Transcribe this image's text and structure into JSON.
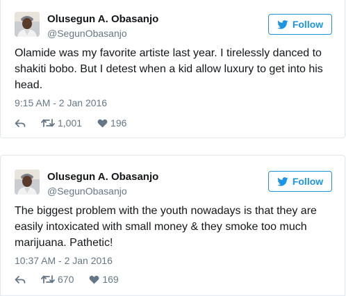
{
  "tweets": [
    {
      "name": "Olusegun A. Obasanjo",
      "handle": "@SegunObasanjo",
      "follow_label": "Follow",
      "text": "Olamide was my favorite artiste last year. I tirelessly danced to shakiti bobo. But I detest when a kid allow luxury to get into his head.",
      "timestamp": "9:15 AM - 2 Jan 2016",
      "retweets": "1,001",
      "likes": "196"
    },
    {
      "name": "Olusegun A. Obasanjo",
      "handle": "@SegunObasanjo",
      "follow_label": "Follow",
      "text": "The biggest problem with the youth nowadays is that they are easily intoxicated with small money & they smoke too much marijuana. Pathetic!",
      "timestamp": "10:37 AM - 2 Jan 2016",
      "retweets": "670",
      "likes": "169"
    }
  ],
  "icons": {
    "follow": "twitter-bird-icon",
    "reply": "reply-icon",
    "retweet": "retweet-icon",
    "like": "heart-icon"
  },
  "colors": {
    "accent": "#1b95e0",
    "muted": "#657786",
    "text": "#14171a",
    "border": "#e1e8ed"
  }
}
